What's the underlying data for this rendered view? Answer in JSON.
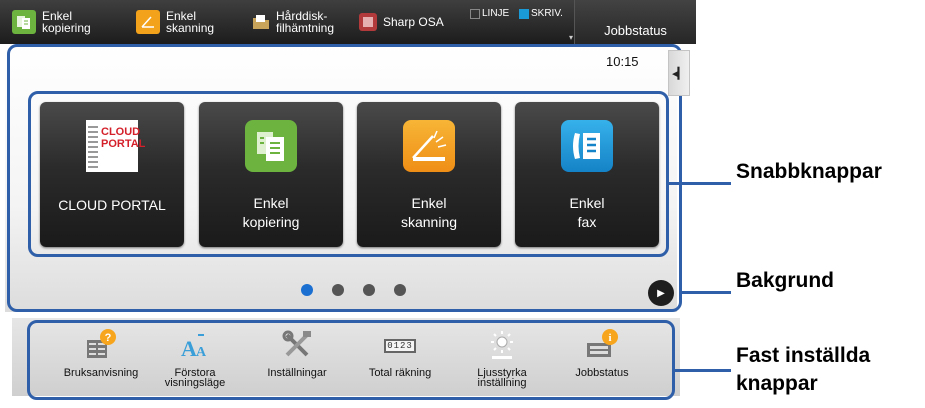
{
  "topbar": {
    "items": [
      {
        "label": "Enkel\nkopiering",
        "icon": "copy-icon",
        "color": "#6cb33f"
      },
      {
        "label": "Enkel\nskanning",
        "icon": "scan-icon",
        "color": "#f2a21b"
      },
      {
        "label": "Hårddisk-\nfilhämtning",
        "icon": "folder-icon",
        "color": "#c8a45a"
      },
      {
        "label": "Sharp OSA",
        "icon": "osa-icon",
        "color": "#b33a3a"
      }
    ],
    "indicators": {
      "line": "LINJE",
      "print": "SKRIV."
    },
    "job_status": "Jobbstatus"
  },
  "clock": "10:15",
  "quick_buttons": [
    {
      "label": "CLOUD PORTAL",
      "icon": "cloud-portal-icon",
      "logo_text": "CLOUD\nPORTAL"
    },
    {
      "label": "Enkel\nkopiering",
      "icon": "copy-icon",
      "color": "#6cb33f"
    },
    {
      "label": "Enkel\nskanning",
      "icon": "scan-icon",
      "color": "#f2a21b"
    },
    {
      "label": "Enkel\nfax",
      "icon": "fax-icon",
      "color": "#1a9ad6"
    }
  ],
  "pager": {
    "count": 4,
    "active": 0,
    "active_color": "#1a6fd1",
    "inactive_color": "#555555"
  },
  "fixed_buttons": [
    {
      "label": "Bruksanvisning",
      "icon": "manual-icon"
    },
    {
      "label": "Förstora\nvisningsläge",
      "icon": "magnify-text-icon"
    },
    {
      "label": "Inställningar",
      "icon": "settings-tools-icon"
    },
    {
      "label": "Total räkning",
      "icon": "counter-icon",
      "counter_text": "0123"
    },
    {
      "label": "Ljusstyrka\ninställning",
      "icon": "brightness-icon"
    },
    {
      "label": "Jobbstatus",
      "icon": "job-status-icon"
    }
  ],
  "callouts": {
    "quick": "Snabbknappar",
    "background": "Bakgrund",
    "fixed": "Fast inställda\nknappar"
  },
  "colors": {
    "frame": "#2f5fa8"
  }
}
